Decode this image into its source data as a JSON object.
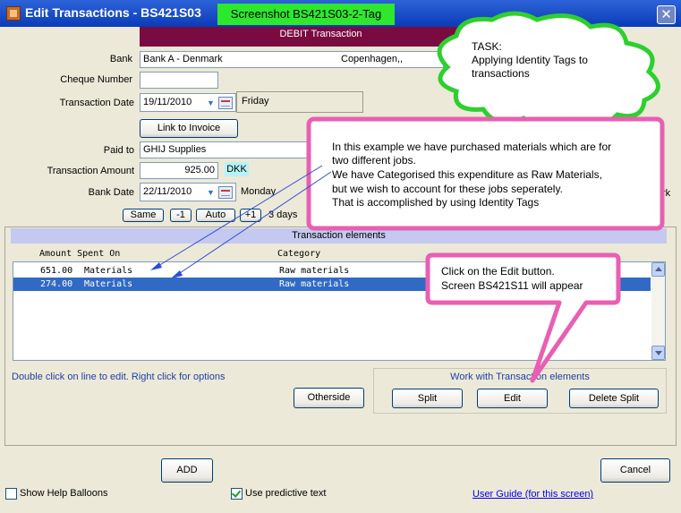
{
  "window": {
    "title": "Edit Transactions - BS421S03",
    "screenshot_tag": "Screenshot BS421S03-2-Tag",
    "close_symbol": "✕"
  },
  "form": {
    "transaction_type": "DEBIT Transaction",
    "bank_label": "Bank",
    "bank_value": "Bank A - Denmark",
    "bank_city": "Copenhagen,,",
    "cheque_label": "Cheque Number",
    "cheque_value": "",
    "tdate_label": "Transaction Date",
    "tdate_value": "19/11/2010",
    "tdate_day": "Friday",
    "link_invoice": "Link to Invoice",
    "paid_to_label": "Paid to",
    "paid_to_value": "GHIJ Supplies",
    "amount_label": "Transaction Amount",
    "amount_value": "925.00",
    "currency": "DKK",
    "bdate_label": "Bank Date",
    "bdate_value": "22/11/2010",
    "bdate_day": "Monday",
    "hidden_right_text": "rk",
    "same": "Same",
    "minus1": "-1",
    "auto": "Auto",
    "plus1": "+1",
    "days": "3 days"
  },
  "elements": {
    "header": "Transaction elements",
    "col_amount": "Amount Spent On",
    "col_category": "Category",
    "rows": [
      {
        "amount": "651.00",
        "spent_on": "Materials",
        "category": "Raw materials"
      },
      {
        "amount": "274.00",
        "spent_on": "Materials",
        "category": "Raw materials"
      }
    ],
    "hint": "Double click on line to edit. Right click for options",
    "otherside": "Otherside",
    "group_title": "Work with Transaction elements",
    "split": "Split",
    "edit": "Edit",
    "delete_split": "Delete Split"
  },
  "bottom": {
    "add": "ADD",
    "cancel": "Cancel",
    "show_help": "Show Help Balloons",
    "show_help_checked": false,
    "predictive": "Use predictive text",
    "predictive_checked": true,
    "user_guide": "User Guide (for this screen)"
  },
  "callouts": {
    "task_line1": "TASK:",
    "task_line2": "Applying Identity Tags to",
    "task_line3": "transactions",
    "example_line1": "In this example we have purchased materials which are for",
    "example_line2": "two different jobs.",
    "example_line3": "We have Categorised this expenditure as Raw Materials,",
    "example_line4": "but we wish to account for these jobs seperately.",
    "example_line5": "That is accomplished by using Identity Tags",
    "click_line1": "Click on the Edit button.",
    "click_line2": "Screen BS421S11 will appear"
  },
  "colors": {
    "titlebar": "#0a3bb8",
    "debit_bar": "#7a0b40",
    "selection": "#316ac5",
    "tag_green": "#2ee82e",
    "callout_border": "#e85fb3",
    "cloud_border": "#2ecf2e"
  }
}
